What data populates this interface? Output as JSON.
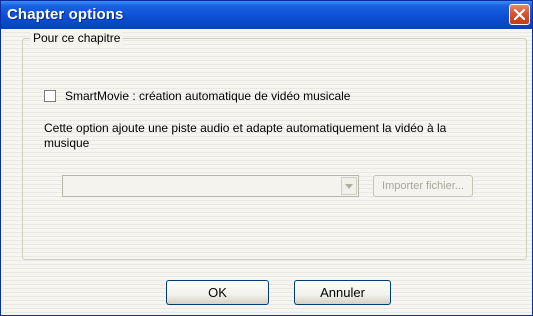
{
  "window": {
    "title": "Chapter options",
    "close_icon": "close-icon"
  },
  "group": {
    "label": "Pour ce chapitre"
  },
  "smartmovie": {
    "checked": false,
    "label": "SmartMovie : création automatique de vidéo musicale"
  },
  "description": "Cette option ajoute une piste audio et adapte automatiquement la vidéo à la musique",
  "combo": {
    "value": "",
    "enabled": false,
    "arrow_icon": "chevron-down-icon"
  },
  "import_button": {
    "label": "Importer fichier...",
    "enabled": false
  },
  "buttons": {
    "ok": "OK",
    "cancel": "Annuler"
  },
  "colors": {
    "titlebar": "#0d4fd4",
    "close_button": "#d9532e"
  }
}
